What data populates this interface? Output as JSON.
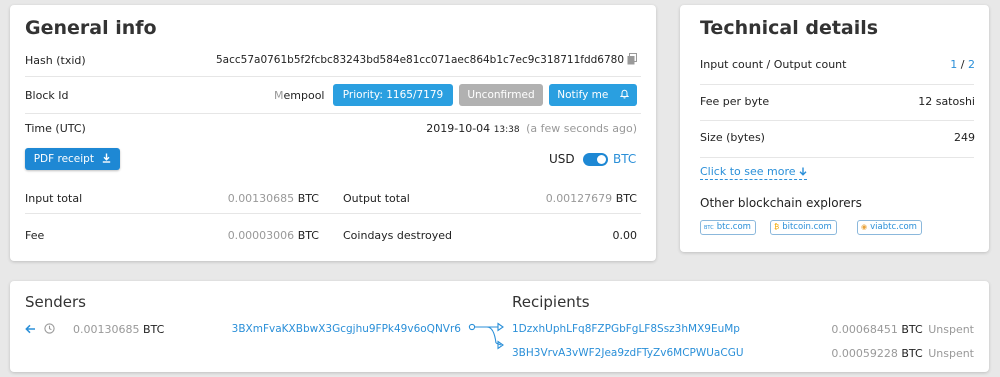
{
  "general": {
    "title": "General info",
    "hash_label": "Hash (txid)",
    "hash_value": "5acc57a0761b5f2fcbc83243bd584e81cc071aec864b1c7ec9c318711fdd6780",
    "block_label": "Block Id",
    "mempool_prefix": "M",
    "mempool_rest": "empool",
    "priority_label": "Priority: 1165/7179",
    "unconfirmed_label": "Unconfirmed",
    "notify_label": "Notify me",
    "time_label": "Time (UTC)",
    "time_date": "2019-10-04",
    "time_clock": "13:38",
    "time_relative": "(a few seconds ago)",
    "pdf_label": "PDF receipt",
    "currency_left": "USD",
    "currency_right": "BTC",
    "input_total_label": "Input total",
    "input_total_prefix": "0.",
    "input_total_value": "00130685",
    "output_total_label": "Output total",
    "output_total_prefix": "0.",
    "output_total_value": "00127679",
    "fee_label": "Fee",
    "fee_prefix": "0.",
    "fee_value": "00003006",
    "coindays_label": "Coindays destroyed",
    "coindays_value": "0.00",
    "unit": "BTC"
  },
  "tech": {
    "title": "Technical details",
    "io_count_label": "Input count / Output count",
    "input_count": "1",
    "slash": "/",
    "output_count": "2",
    "fee_per_byte_label": "Fee per byte",
    "fee_per_byte_value": "12 satoshi",
    "size_label": "Size (bytes)",
    "size_value": "249",
    "see_more_label": "Click to see more",
    "explorers_title": "Other blockchain explorers",
    "explorers": [
      {
        "label": "btc.com",
        "icon": "btc-com-logo-icon",
        "glyph": "BTC"
      },
      {
        "label": "bitcoin.com",
        "icon": "bitcoin-com-logo-icon",
        "glyph": "₿"
      },
      {
        "label": "viabtc.com",
        "icon": "viabtc-logo-icon",
        "glyph": "◉"
      }
    ]
  },
  "io": {
    "senders_title": "Senders",
    "recipients_title": "Recipients",
    "sender": {
      "amount_prefix": "0.",
      "amount": "00130685",
      "unit": "BTC",
      "address": "3BXmFvaKXBbwX3Gcgjhu9FPk49v6oQNVr6"
    },
    "recipients": [
      {
        "address": "1DzxhUphLFq8FZPGbFgLF8Ssz3hMX9EuMp",
        "amount_prefix": "0.",
        "amount": "00068451",
        "unit": "BTC",
        "status": "Unspent"
      },
      {
        "address": "3BH3VrvA3vWF2Jea9zdFTyZv6MCPWUaCGU",
        "amount_prefix": "0.",
        "amount": "00059228",
        "unit": "BTC",
        "status": "Unspent"
      }
    ]
  },
  "colors": {
    "accent": "#2a9fe0",
    "link": "#2a8fd8",
    "unconfirmed": "#b1b1b1",
    "background": "#e8e8e8"
  }
}
